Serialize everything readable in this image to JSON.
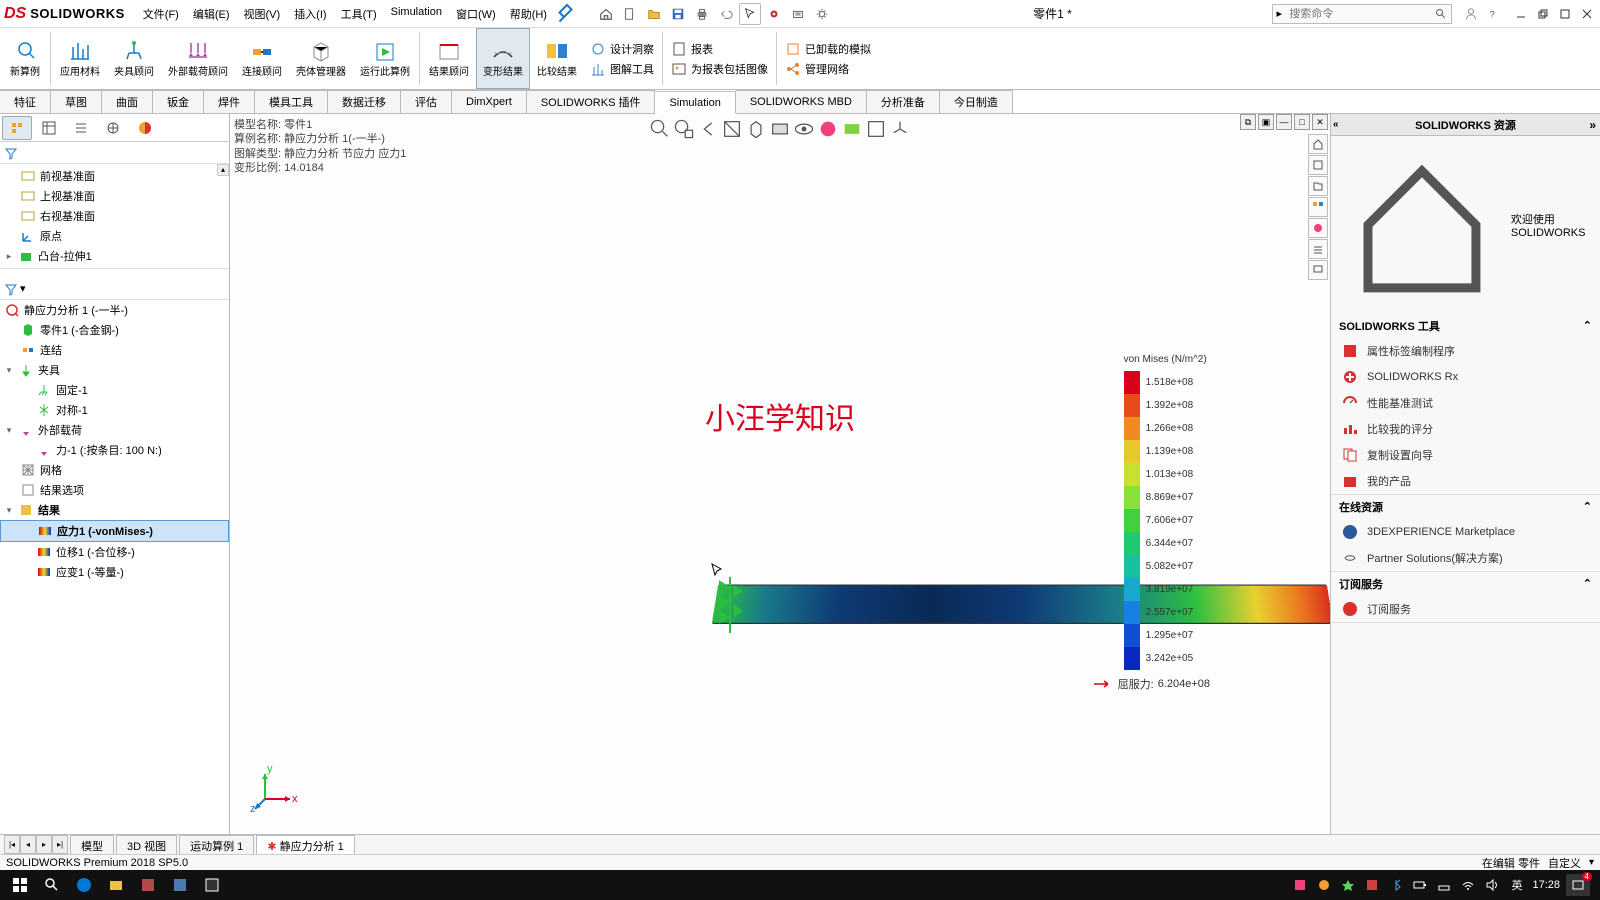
{
  "app": {
    "logo_ds": "DS",
    "logo_text": "SOLIDWORKS",
    "doc_name": "零件1 *"
  },
  "menus": {
    "file": "文件(F)",
    "edit": "编辑(E)",
    "view": "视图(V)",
    "insert": "插入(I)",
    "tools": "工具(T)",
    "simulation": "Simulation",
    "window": "窗口(W)",
    "help": "帮助(H)"
  },
  "search_placeholder": "搜索命令",
  "ribbon": {
    "new_study": "新算例",
    "apply_material": "应用材料",
    "fixture_advisor": "夹具顾问",
    "external_load": "外部载荷顾问",
    "connection": "连接顾问",
    "shell_mgr": "壳体管理器",
    "run_study": "运行此算例",
    "result_advisor": "结果顾问",
    "deform_result": "变形结果",
    "compare_result": "比较结果",
    "design_insight": "设计洞察",
    "plot_tools": "图解工具",
    "report": "报表",
    "include_image": "为报表包括图像",
    "unloaded_sim": "已卸载的模拟",
    "manage_network": "管理网络"
  },
  "feature_tabs": {
    "feature": "特征",
    "sketch": "草图",
    "surface": "曲面",
    "sheetmetal": "钣金",
    "weldment": "焊件",
    "mold": "模具工具",
    "data": "数据迁移",
    "evaluate": "评估",
    "dimxpert": "DimXpert",
    "sw_addin": "SOLIDWORKS 插件",
    "sim": "Simulation",
    "mbd": "SOLIDWORKS MBD",
    "analysis": "分析准备",
    "today": "今日制造"
  },
  "tree": {
    "plane_front": "前视基准面",
    "plane_top": "上视基准面",
    "plane_right": "右视基准面",
    "origin": "原点",
    "extrude": "凸台-拉伸1",
    "study": "静应力分析 1 (-一半-)",
    "part": "零件1 (-合金钢-)",
    "connections": "连结",
    "fixtures": "夹具",
    "fix1": "固定-1",
    "sym1": "对称-1",
    "external_loads": "外部载荷",
    "force1": "力-1 (:按条目: 100 N:)",
    "mesh": "网格",
    "result_opts": "结果选项",
    "results": "结果",
    "stress1": "应力1 (-vonMises-)",
    "disp1": "位移1 (-合位移-)",
    "strain1": "应变1 (-等量-)"
  },
  "model_info": {
    "l1": "模型名称: 零件1",
    "l2": "算例名称: 静应力分析 1(-一半-)",
    "l3": "图解类型: 静应力分析 节应力 应力1",
    "l4": "变形比例: 14.0184"
  },
  "watermark": "小汪学知识",
  "legend": {
    "title": "von Mises (N/m^2)",
    "vals": [
      "1.518e+08",
      "1.392e+08",
      "1.266e+08",
      "1.139e+08",
      "1.013e+08",
      "8.869e+07",
      "7.606e+07",
      "6.344e+07",
      "5.082e+07",
      "3.819e+07",
      "2.557e+07",
      "1.295e+07",
      "3.242e+05"
    ],
    "colors": [
      "#d9001b",
      "#e84a1a",
      "#f08a20",
      "#e8c82a",
      "#c8e030",
      "#88e038",
      "#40d040",
      "#20c870",
      "#18c0a0",
      "#18a8d0",
      "#1880e0",
      "#1050d0",
      "#0828c0"
    ],
    "yield_label": "屈服力:",
    "yield_val": "6.204e+08"
  },
  "right_panel": {
    "header": "SOLIDWORKS 资源",
    "welcome": "欢迎使用 SOLIDWORKS",
    "tools_head": "SOLIDWORKS 工具",
    "tools": {
      "prop_tab": "属性标签编制程序",
      "rx": "SOLIDWORKS Rx",
      "benchmark": "性能基准测试",
      "compare": "比较我的评分",
      "copy_settings": "复制设置向导",
      "my_products": "我的产品"
    },
    "online_head": "在线资源",
    "online": {
      "marketplace": "3DEXPERIENCE Marketplace",
      "partners": "Partner Solutions(解决方案)"
    },
    "subscribe_head": "订阅服务",
    "subscribe": "订阅服务"
  },
  "bottom_tabs": {
    "model": "模型",
    "view3d": "3D 视图",
    "motion": "运动算例 1",
    "study": "静应力分析 1"
  },
  "status": {
    "left": "SOLIDWORKS Premium 2018 SP5.0",
    "editing": "在编辑 零件",
    "custom": "自定义"
  },
  "taskbar": {
    "ime": "英",
    "time": "17:28",
    "notif_count": "4"
  },
  "axis": {
    "x": "x",
    "y": "y",
    "z": "z"
  }
}
